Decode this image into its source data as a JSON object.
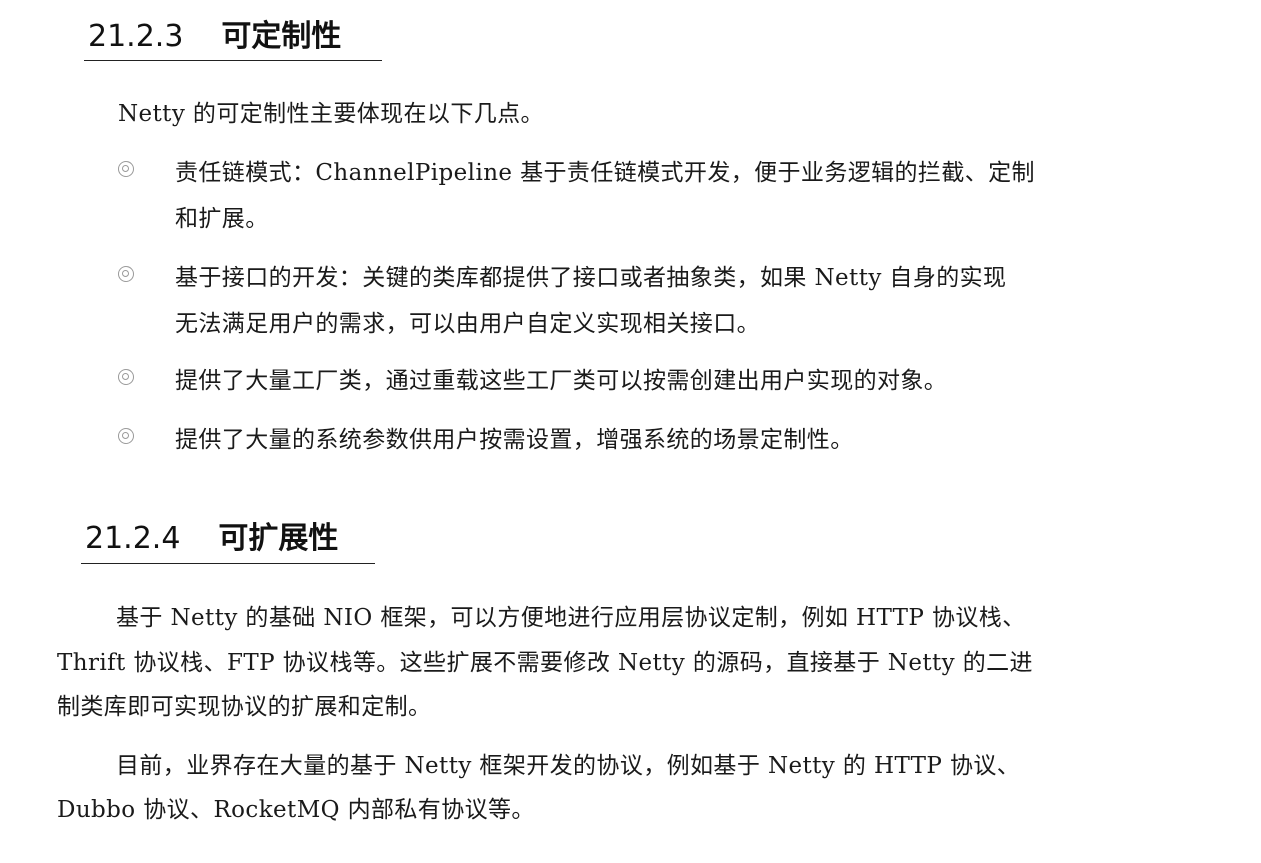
{
  "section_1": {
    "number": "21.2.3",
    "title": "可定制性",
    "intro": "Netty 的可定制性主要体现在以下几点。",
    "bullets": [
      {
        "line1": "责任链模式：ChannelPipeline 基于责任链模式开发，便于业务逻辑的拦截、定制",
        "line2": "和扩展。"
      },
      {
        "line1": "基于接口的开发：关键的类库都提供了接口或者抽象类，如果 Netty 自身的实现",
        "line2": "无法满足用户的需求，可以由用户自定义实现相关接口。"
      },
      {
        "line1": "提供了大量工厂类，通过重载这些工厂类可以按需创建出用户实现的对象。"
      },
      {
        "line1": "提供了大量的系统参数供用户按需设置，增强系统的场景定制性。"
      }
    ]
  },
  "section_2": {
    "number": "21.2.4",
    "title": "可扩展性",
    "paragraph_1": {
      "line1": "基于 Netty 的基础 NIO 框架，可以方便地进行应用层协议定制，例如 HTTP 协议栈、",
      "line2": "Thrift 协议栈、FTP 协议栈等。这些扩展不需要修改 Netty 的源码，直接基于 Netty 的二进",
      "line3": "制类库即可实现协议的扩展和定制。"
    },
    "paragraph_2": {
      "line1": "目前，业界存在大量的基于 Netty 框架开发的协议，例如基于 Netty 的 HTTP 协议、",
      "line2": "Dubbo 协议、RocketMQ 内部私有协议等。"
    }
  }
}
